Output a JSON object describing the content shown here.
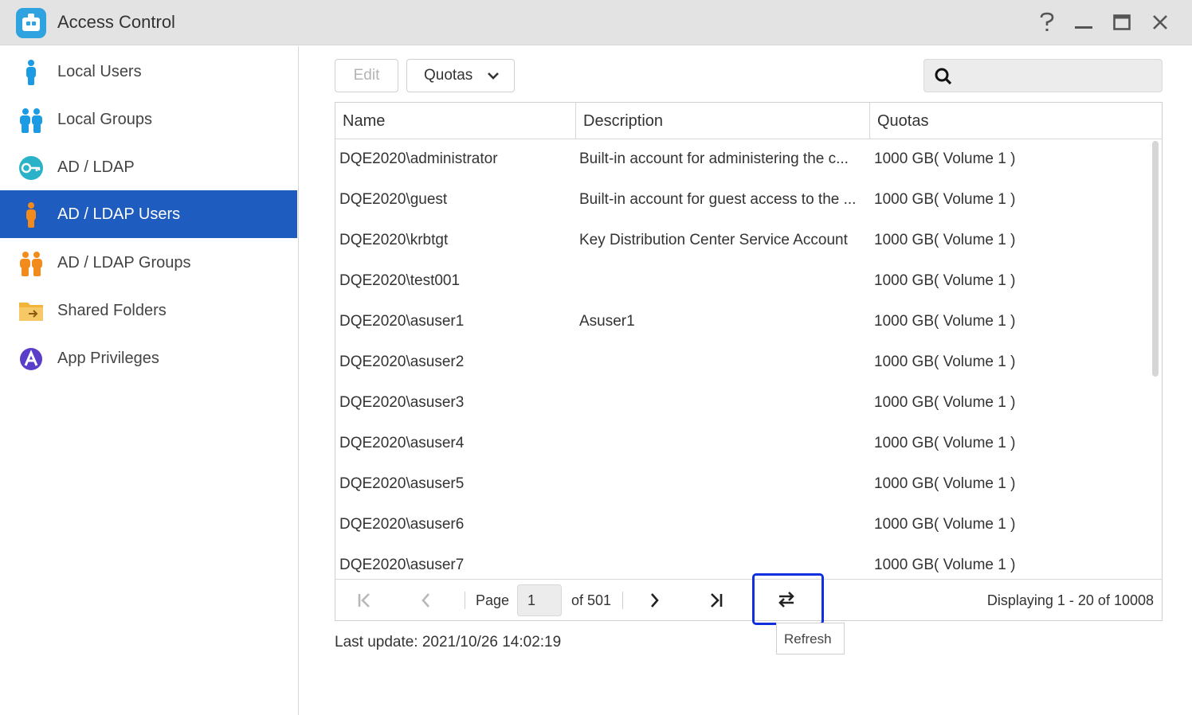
{
  "window": {
    "title": "Access Control",
    "controls": [
      "help-icon",
      "minimize-icon",
      "maximize-icon",
      "close-icon"
    ]
  },
  "sidebar": {
    "items": [
      {
        "label": "Local Users",
        "icon": "user-icon",
        "color": "#1a9be3"
      },
      {
        "label": "Local Groups",
        "icon": "group-icon",
        "color": "#1a9be3"
      },
      {
        "label": "AD / LDAP",
        "icon": "key-icon",
        "color": "#2ab3c8"
      },
      {
        "label": "AD / LDAP Users",
        "icon": "user-icon",
        "color": "#f28b1b",
        "active": true
      },
      {
        "label": "AD / LDAP Groups",
        "icon": "group-icon",
        "color": "#f28b1b"
      },
      {
        "label": "Shared Folders",
        "icon": "folder-icon",
        "color": "#f3b43a"
      },
      {
        "label": "App Privileges",
        "icon": "app-privileges-icon",
        "color": "#5a3dc8"
      }
    ],
    "active_color": "#1f5cbf"
  },
  "toolbar": {
    "edit_label": "Edit",
    "quotas_label": "Quotas",
    "search_placeholder": ""
  },
  "grid": {
    "columns": [
      "Name",
      "Description",
      "Quotas"
    ],
    "rows": [
      {
        "name": "DQE2020\\administrator",
        "description": "Built-in account for administering the c...",
        "quota": "1000 GB( Volume 1 )"
      },
      {
        "name": "DQE2020\\guest",
        "description": "Built-in account for guest access to the ...",
        "quota": "1000 GB( Volume 1 )"
      },
      {
        "name": "DQE2020\\krbtgt",
        "description": "Key Distribution Center Service Account",
        "quota": "1000 GB( Volume 1 )"
      },
      {
        "name": "DQE2020\\test001",
        "description": "",
        "quota": "1000 GB( Volume 1 )"
      },
      {
        "name": "DQE2020\\asuser1",
        "description": "Asuser1",
        "quota": "1000 GB( Volume 1 )"
      },
      {
        "name": "DQE2020\\asuser2",
        "description": "",
        "quota": "1000 GB( Volume 1 )"
      },
      {
        "name": "DQE2020\\asuser3",
        "description": "",
        "quota": "1000 GB( Volume 1 )"
      },
      {
        "name": "DQE2020\\asuser4",
        "description": "",
        "quota": "1000 GB( Volume 1 )"
      },
      {
        "name": "DQE2020\\asuser5",
        "description": "",
        "quota": "1000 GB( Volume 1 )"
      },
      {
        "name": "DQE2020\\asuser6",
        "description": "",
        "quota": "1000 GB( Volume 1 )"
      },
      {
        "name": "DQE2020\\asuser7",
        "description": "",
        "quota": "1000 GB( Volume 1 )"
      }
    ]
  },
  "pager": {
    "page_label": "Page",
    "page_value": "1",
    "of_label": "of 501",
    "display_text": "Displaying 1 - 20 of 10008"
  },
  "refresh": {
    "tooltip": "Refresh",
    "highlight_color": "#1030e0"
  },
  "footer": {
    "last_update": "Last update: 2021/10/26 14:02:19"
  }
}
